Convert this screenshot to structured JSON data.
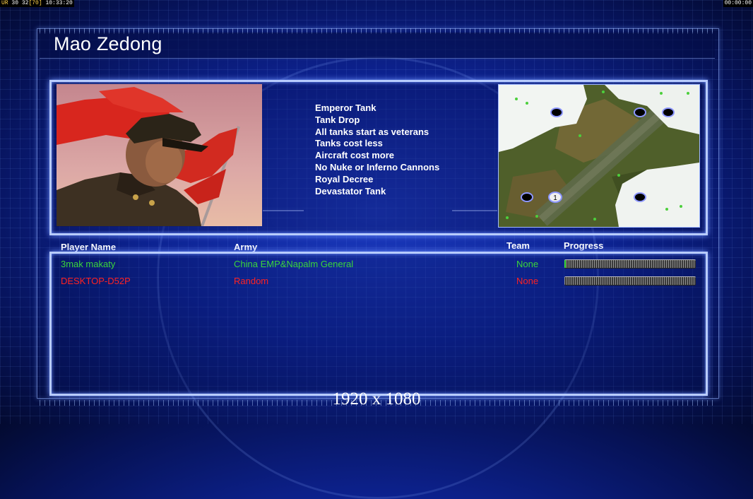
{
  "hud": {
    "left_prefix": "UR",
    "left_values": "30 32",
    "left_bracket": "[70]",
    "left_clock": "10:33:20",
    "right_clock": "00:00:00"
  },
  "general": {
    "name": "Mao Zedong",
    "features": [
      "Emperor Tank",
      "Tank Drop",
      "All tanks start as veterans",
      "Tanks cost less",
      "Aircraft cost more",
      "No Nuke or Inferno Cannons",
      "Royal Decree",
      "Devastator Tank"
    ]
  },
  "map": {
    "start_marker_label": "1"
  },
  "table": {
    "headers": {
      "player": "Player Name",
      "army": "Army",
      "team": "Team",
      "progress": "Progress"
    },
    "rows": [
      {
        "player": "3mak makaty",
        "army": "China EMP&Napalm General",
        "team": "None",
        "progress": 0.01,
        "color": "#3bd63b"
      },
      {
        "player": "DESKTOP-D52P",
        "army": "Random",
        "team": "None",
        "progress": 0.0,
        "color": "#ff2222"
      }
    ]
  },
  "resolution": "1920 x 1080"
}
